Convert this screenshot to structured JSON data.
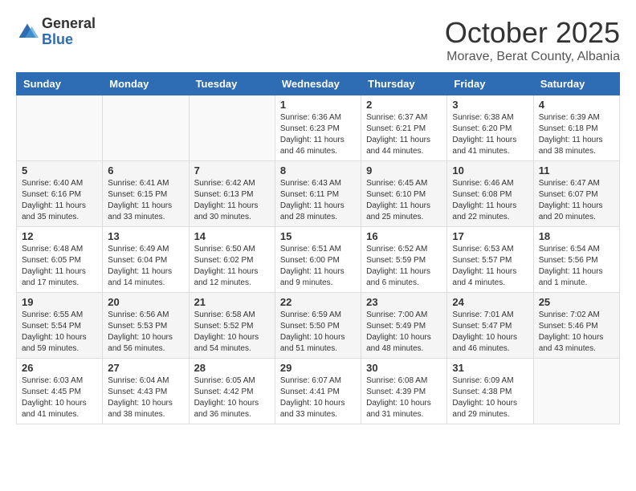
{
  "header": {
    "logo": {
      "general": "General",
      "blue": "Blue"
    },
    "title": "October 2025",
    "subtitle": "Morave, Berat County, Albania"
  },
  "calendar": {
    "days_of_week": [
      "Sunday",
      "Monday",
      "Tuesday",
      "Wednesday",
      "Thursday",
      "Friday",
      "Saturday"
    ],
    "weeks": [
      [
        {
          "day": "",
          "info": ""
        },
        {
          "day": "",
          "info": ""
        },
        {
          "day": "",
          "info": ""
        },
        {
          "day": "1",
          "info": "Sunrise: 6:36 AM\nSunset: 6:23 PM\nDaylight: 11 hours and 46 minutes."
        },
        {
          "day": "2",
          "info": "Sunrise: 6:37 AM\nSunset: 6:21 PM\nDaylight: 11 hours and 44 minutes."
        },
        {
          "day": "3",
          "info": "Sunrise: 6:38 AM\nSunset: 6:20 PM\nDaylight: 11 hours and 41 minutes."
        },
        {
          "day": "4",
          "info": "Sunrise: 6:39 AM\nSunset: 6:18 PM\nDaylight: 11 hours and 38 minutes."
        }
      ],
      [
        {
          "day": "5",
          "info": "Sunrise: 6:40 AM\nSunset: 6:16 PM\nDaylight: 11 hours and 35 minutes."
        },
        {
          "day": "6",
          "info": "Sunrise: 6:41 AM\nSunset: 6:15 PM\nDaylight: 11 hours and 33 minutes."
        },
        {
          "day": "7",
          "info": "Sunrise: 6:42 AM\nSunset: 6:13 PM\nDaylight: 11 hours and 30 minutes."
        },
        {
          "day": "8",
          "info": "Sunrise: 6:43 AM\nSunset: 6:11 PM\nDaylight: 11 hours and 28 minutes."
        },
        {
          "day": "9",
          "info": "Sunrise: 6:45 AM\nSunset: 6:10 PM\nDaylight: 11 hours and 25 minutes."
        },
        {
          "day": "10",
          "info": "Sunrise: 6:46 AM\nSunset: 6:08 PM\nDaylight: 11 hours and 22 minutes."
        },
        {
          "day": "11",
          "info": "Sunrise: 6:47 AM\nSunset: 6:07 PM\nDaylight: 11 hours and 20 minutes."
        }
      ],
      [
        {
          "day": "12",
          "info": "Sunrise: 6:48 AM\nSunset: 6:05 PM\nDaylight: 11 hours and 17 minutes."
        },
        {
          "day": "13",
          "info": "Sunrise: 6:49 AM\nSunset: 6:04 PM\nDaylight: 11 hours and 14 minutes."
        },
        {
          "day": "14",
          "info": "Sunrise: 6:50 AM\nSunset: 6:02 PM\nDaylight: 11 hours and 12 minutes."
        },
        {
          "day": "15",
          "info": "Sunrise: 6:51 AM\nSunset: 6:00 PM\nDaylight: 11 hours and 9 minutes."
        },
        {
          "day": "16",
          "info": "Sunrise: 6:52 AM\nSunset: 5:59 PM\nDaylight: 11 hours and 6 minutes."
        },
        {
          "day": "17",
          "info": "Sunrise: 6:53 AM\nSunset: 5:57 PM\nDaylight: 11 hours and 4 minutes."
        },
        {
          "day": "18",
          "info": "Sunrise: 6:54 AM\nSunset: 5:56 PM\nDaylight: 11 hours and 1 minute."
        }
      ],
      [
        {
          "day": "19",
          "info": "Sunrise: 6:55 AM\nSunset: 5:54 PM\nDaylight: 10 hours and 59 minutes."
        },
        {
          "day": "20",
          "info": "Sunrise: 6:56 AM\nSunset: 5:53 PM\nDaylight: 10 hours and 56 minutes."
        },
        {
          "day": "21",
          "info": "Sunrise: 6:58 AM\nSunset: 5:52 PM\nDaylight: 10 hours and 54 minutes."
        },
        {
          "day": "22",
          "info": "Sunrise: 6:59 AM\nSunset: 5:50 PM\nDaylight: 10 hours and 51 minutes."
        },
        {
          "day": "23",
          "info": "Sunrise: 7:00 AM\nSunset: 5:49 PM\nDaylight: 10 hours and 48 minutes."
        },
        {
          "day": "24",
          "info": "Sunrise: 7:01 AM\nSunset: 5:47 PM\nDaylight: 10 hours and 46 minutes."
        },
        {
          "day": "25",
          "info": "Sunrise: 7:02 AM\nSunset: 5:46 PM\nDaylight: 10 hours and 43 minutes."
        }
      ],
      [
        {
          "day": "26",
          "info": "Sunrise: 6:03 AM\nSunset: 4:45 PM\nDaylight: 10 hours and 41 minutes."
        },
        {
          "day": "27",
          "info": "Sunrise: 6:04 AM\nSunset: 4:43 PM\nDaylight: 10 hours and 38 minutes."
        },
        {
          "day": "28",
          "info": "Sunrise: 6:05 AM\nSunset: 4:42 PM\nDaylight: 10 hours and 36 minutes."
        },
        {
          "day": "29",
          "info": "Sunrise: 6:07 AM\nSunset: 4:41 PM\nDaylight: 10 hours and 33 minutes."
        },
        {
          "day": "30",
          "info": "Sunrise: 6:08 AM\nSunset: 4:39 PM\nDaylight: 10 hours and 31 minutes."
        },
        {
          "day": "31",
          "info": "Sunrise: 6:09 AM\nSunset: 4:38 PM\nDaylight: 10 hours and 29 minutes."
        },
        {
          "day": "",
          "info": ""
        }
      ]
    ]
  }
}
